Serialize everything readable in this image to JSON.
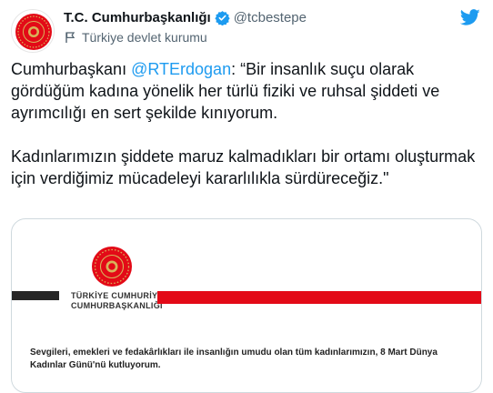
{
  "account": {
    "display_name": "T.C. Cumhurbaşkanlığı",
    "handle": "@tcbestepe",
    "label": "Türkiye devlet kurumu"
  },
  "tweet": {
    "text_prefix": "Cumhurbaşkanı ",
    "mention": "@RTErdogan",
    "text_rest": ": “Bir insanlık suçu olarak gördüğüm kadına yönelik her türlü fiziki ve ruhsal şiddeti ve ayrımcılığı en sert şekilde kınıyorum.",
    "paragraph2": "Kadınlarımızın şiddete maruz kalmadıkları bir ortamı oluşturmak için verdiğimiz mücadeleyi kararlılıkla sürdüreceğiz.\""
  },
  "media": {
    "institution_line1": "TÜRKİYE CUMHURİYETİ",
    "institution_line2": "CUMHURBAŞKANLIĞI",
    "message": "Sevgileri, emekleri ve fedakârlıkları ile insanlığın umudu olan tüm kadınlarımızın, 8 Mart Dünya Kadınlar Günü'nü kutluyorum."
  },
  "icons": {
    "verified": "verified-badge-icon",
    "label": "government-flag-icon",
    "logo": "twitter-bird-icon",
    "emblem": "presidential-seal-icon"
  },
  "colors": {
    "accent": "#1d9bf0",
    "seal_red": "#e30a17",
    "muted": "#536471",
    "gold": "#d8b35a"
  }
}
